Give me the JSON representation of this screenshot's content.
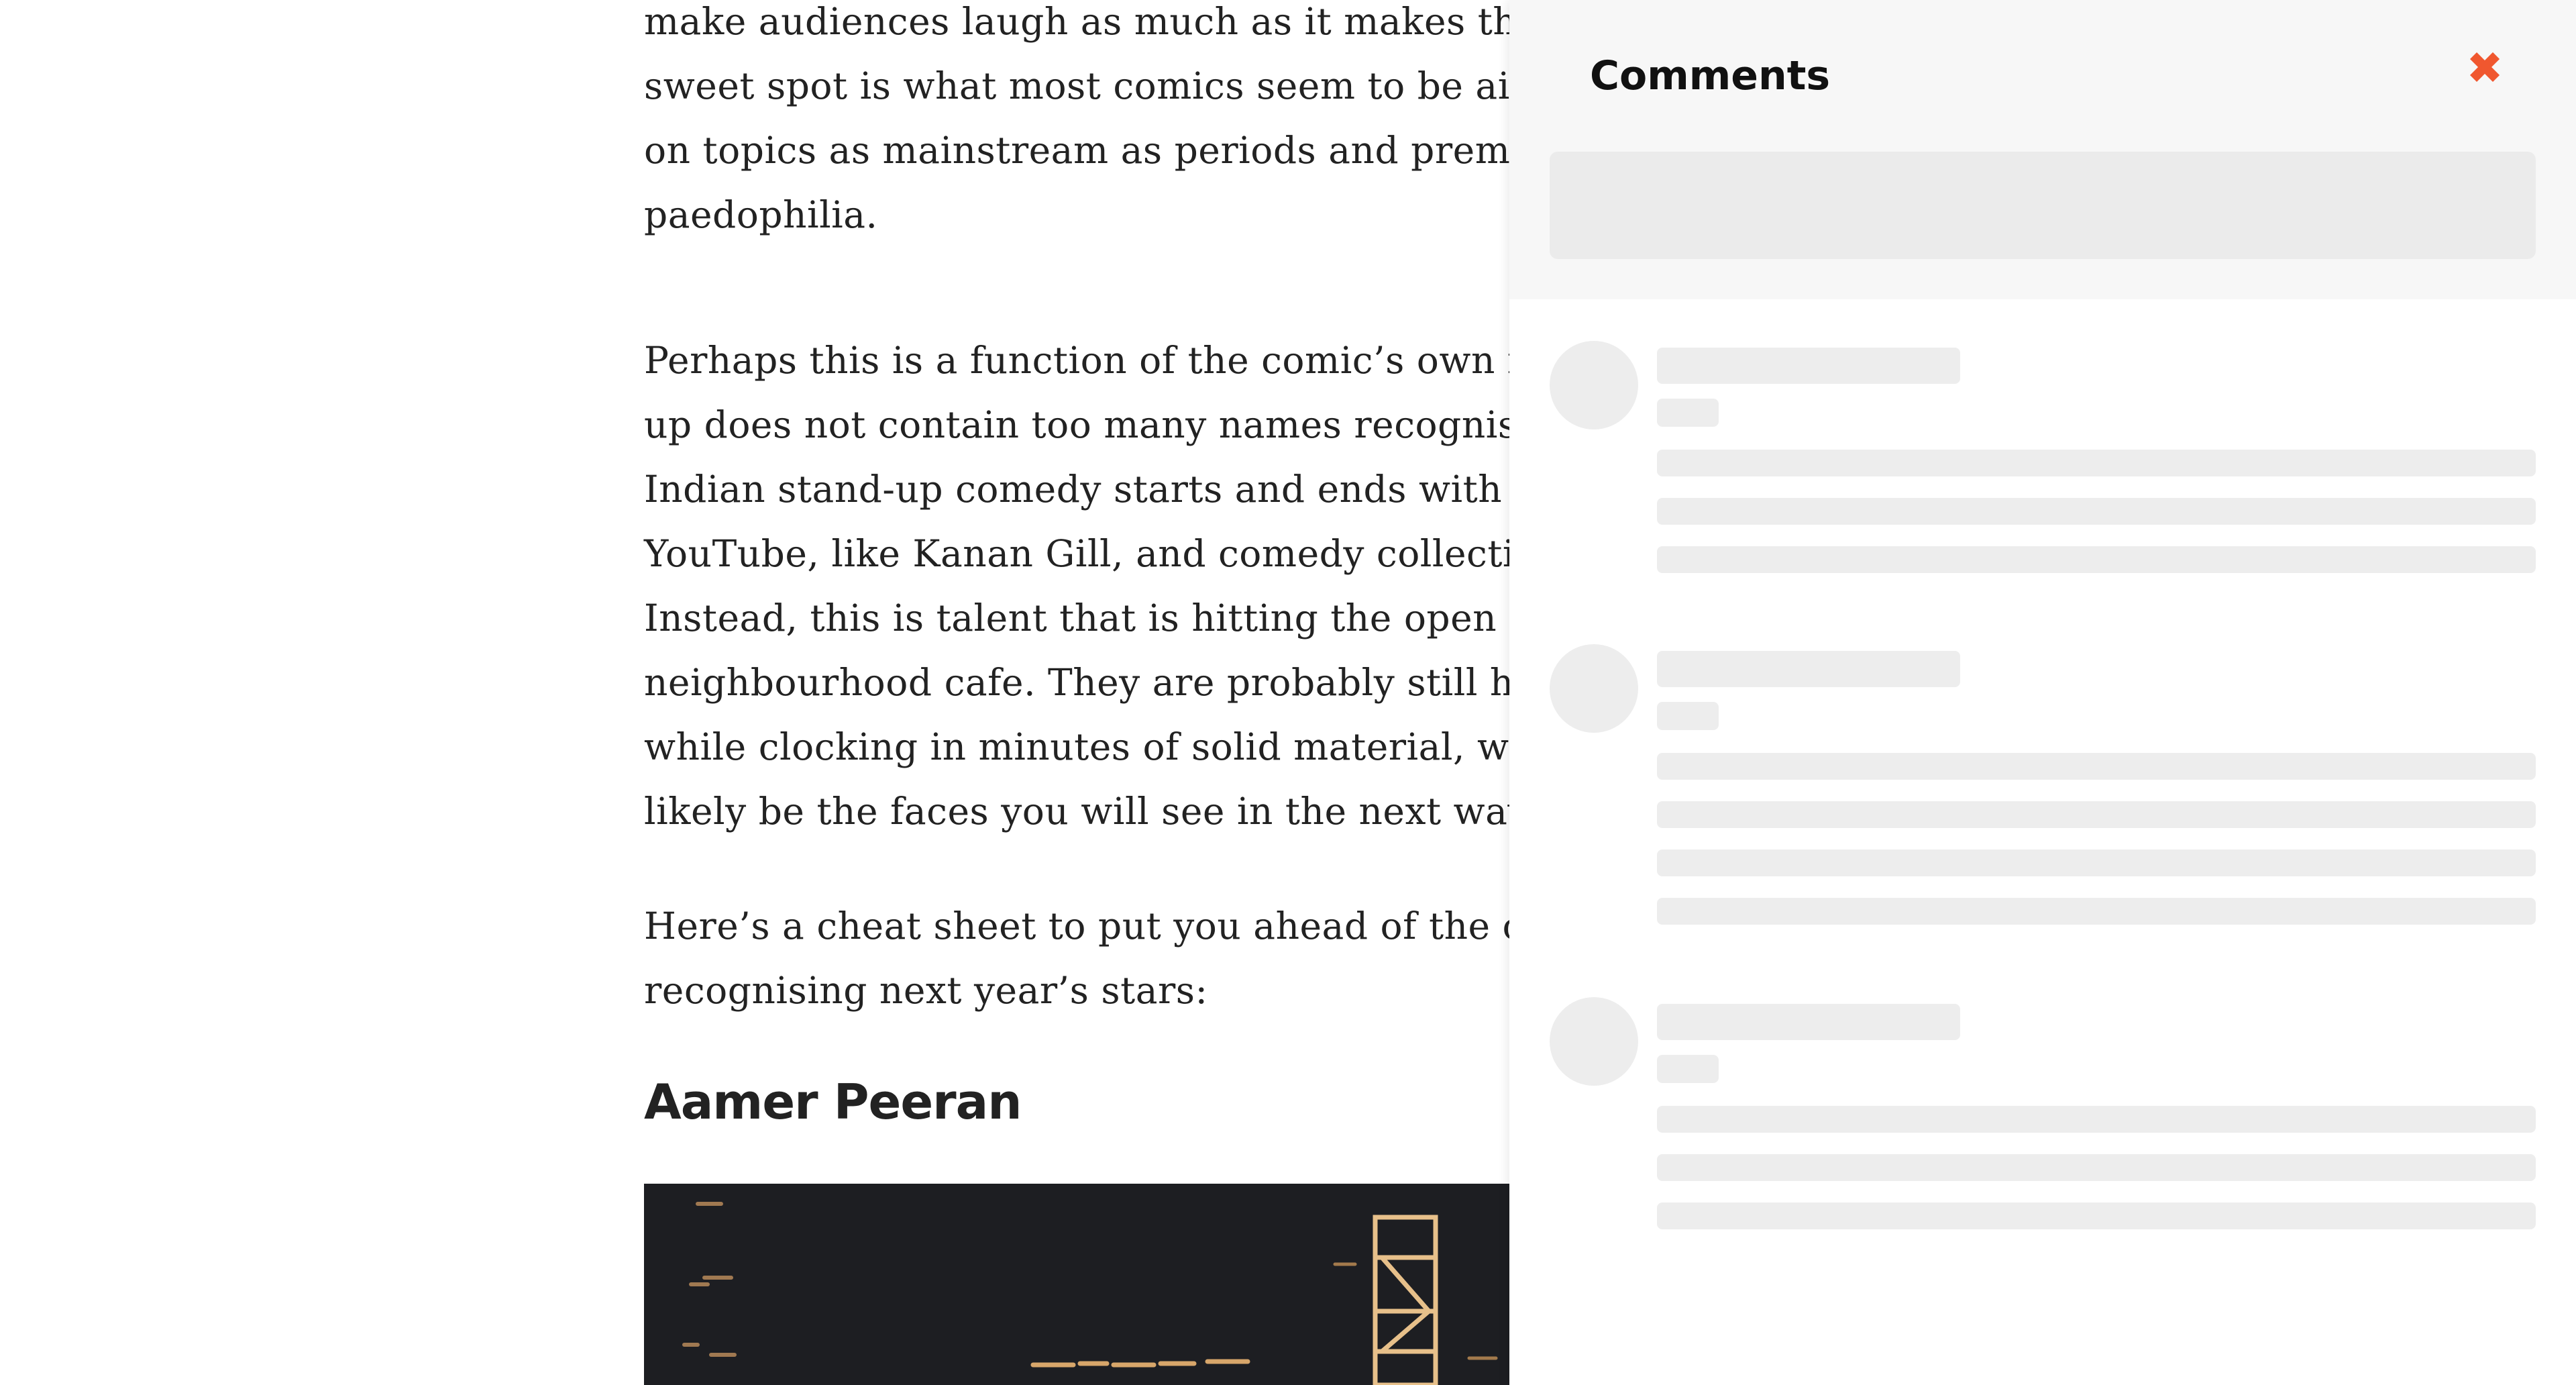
{
  "article": {
    "paragraph_1_lines": [
      "make audiences laugh as much as it makes them u",
      "sweet spot is what most comics seem to be aiming",
      "on topics as mainstream as periods and premarita",
      "paedophilia."
    ],
    "paragraph_2_lines": [
      "Perhaps this is a function of the comic’s own indep",
      "up does not contain too many names recognisable",
      "Indian stand-up comedy starts and ends with stars",
      "YouTube, like Kanan Gill, and comedy collectives li",
      "Instead, this is talent that is hitting the open mic ci",
      "neighbourhood cafe. They are probably still holdin",
      "while clocking in minutes of solid material, week a",
      "likely be the faces you will see in the next wave of"
    ],
    "paragraph_3_lines": [
      "Here’s a cheat sheet to put you ahead of the curve",
      "recognising next year’s stars:"
    ],
    "section_heading": "Aamer Peeran"
  },
  "comments_panel": {
    "title": "Comments",
    "close_icon": "close-icon",
    "accent_color": "#f0572f",
    "skeleton_color": "#ededed",
    "loading_placeholders": 3
  }
}
